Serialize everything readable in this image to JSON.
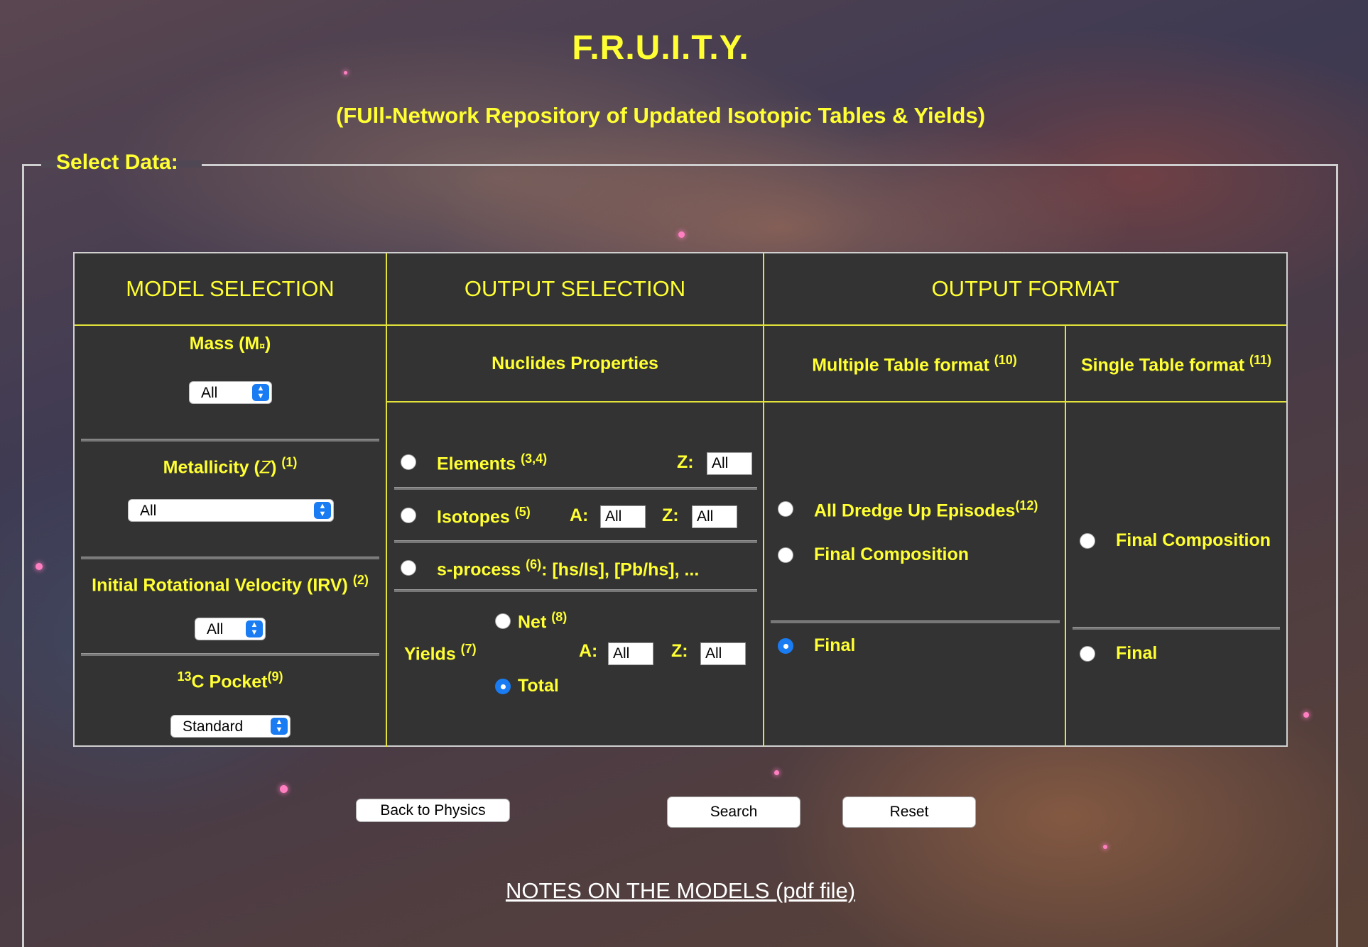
{
  "title": "F.R.U.I.T.Y.",
  "subtitle": "(FUll-Network Repository of Updated Isotopic Tables & Yields)",
  "legend": "Select Data:",
  "columns": {
    "model": "MODEL SELECTION",
    "output": "OUTPUT SELECTION",
    "format": "OUTPUT FORMAT"
  },
  "model": {
    "mass_label": "Mass (M",
    "mass_sun": "¤",
    "mass_close": ")",
    "mass_value": "All",
    "metal_label": "Metallicity (",
    "metal_z": "Z",
    "metal_close": ")",
    "metal_note": "(1)",
    "metal_value": "All",
    "irv_label": "Initial Rotational Velocity (IRV)",
    "irv_note": "(2)",
    "irv_value": "All",
    "c13_sup": "13",
    "c13_label": "C Pocket",
    "c13_note": "(9)",
    "c13_value": "Standard"
  },
  "output": {
    "header": "Nuclides Properties",
    "elements_label": "Elements",
    "elements_note": "(3,4)",
    "z_label": "Z:",
    "a_label": "A:",
    "elements_z": "All",
    "isotopes_label": "Isotopes",
    "isotopes_note": "(5)",
    "isotopes_a": "All",
    "isotopes_z": "All",
    "sprocess_label": "s-process",
    "sprocess_note": "(6)",
    "sprocess_desc": ": [hs/ls], [Pb/hs], ...",
    "yields_label": "Yields",
    "yields_note": "(7)",
    "net_label": "Net",
    "net_note": "(8)",
    "total_label": "Total",
    "yields_a": "All",
    "yields_z": "All"
  },
  "format": {
    "multiple_header": "Multiple Table format",
    "multiple_note": "(10)",
    "single_header": "Single Table format",
    "single_note": "(11)",
    "all_dredge": "All Dredge Up Episodes",
    "all_dredge_note": "(12)",
    "final_composition_multi": "Final Composition",
    "final_multi": "Final",
    "final_composition_single": "Final Composition",
    "final_single": "Final"
  },
  "buttons": {
    "back": "Back to Physics",
    "search": "Search",
    "reset": "Reset"
  },
  "notes_link": "NOTES ON THE MODELS (pdf file)"
}
